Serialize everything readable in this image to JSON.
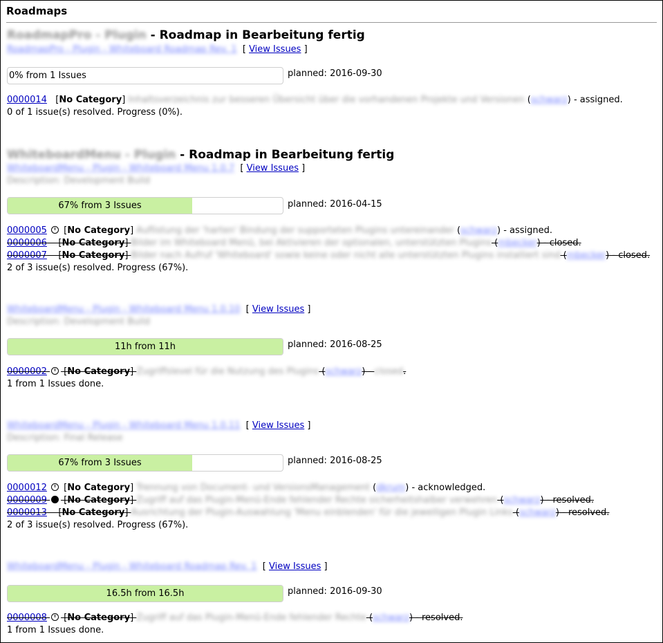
{
  "page": {
    "title": "Roadmaps"
  },
  "view_issues_label": "View Issues",
  "planned_label": "planned:",
  "blocks": [
    {
      "project": "RoadmapPro - Plugin",
      "heading_suffix": "- Roadmap in Bearbeitung fertig",
      "version_link": "RoadmapPro - Plugin - Whiteboard Roadmap Rev. 1",
      "description": "",
      "progress": {
        "text": "0% from 1 Issues",
        "fraction": 0.0
      },
      "planned_date": "2016-09-30",
      "issues": [
        {
          "id": "0000014",
          "icon": "",
          "category": "No Category",
          "summary": "Inhaltsverzeichnis zur besseren Übersicht über die vorhandenen Projekte und Versionen",
          "handler": "schwarz",
          "status": "assigned",
          "struck": false
        }
      ],
      "summary": "0 of 1 issue(s) resolved. Progress (0%)."
    },
    {
      "project": "WhiteboardMenu - Plugin",
      "heading_suffix": "- Roadmap in Bearbeitung fertig",
      "version_link": "WhiteboardMenu - Plugin - Whiteboard Menu 1.0.7",
      "description": "Description: Development Build",
      "progress": {
        "text": "67% from 3 Issues",
        "fraction": 0.67
      },
      "planned_date": "2016-04-15",
      "issues": [
        {
          "id": "0000005",
          "icon": "clock",
          "category": "No Category",
          "summary": "Auflistung der 'harten' Bindung der supporteten Plugins untereinander",
          "handler": "schwarz",
          "status": "assigned",
          "struck": false
        },
        {
          "id": "0000006",
          "icon": "",
          "category": "No Category",
          "summary": "Bilder im Whiteboard Menü, bei Aktivieren der optionalen, unterstützten Plugins",
          "handler": "mbecker",
          "status": "closed",
          "struck": true
        },
        {
          "id": "0000007",
          "icon": "",
          "category": "No Category",
          "summary": "Bilder nach Aufruf 'Whiteboard' sowie keine oder nicht alle unterstützten Plugins installiert sind",
          "handler": "mbecker",
          "status": "closed",
          "struck": true
        }
      ],
      "summary": "2 of 3 issue(s) resolved. Progress (67%)."
    },
    {
      "project": "",
      "heading_suffix": "",
      "version_link": "WhiteboardMenu - Plugin - Whiteboard Menu 1.0.10",
      "description": "Description: Development Build",
      "progress": {
        "text": "11h from 11h",
        "fraction": 1.0
      },
      "planned_date": "2016-08-25",
      "issues": [
        {
          "id": "0000002",
          "icon": "clock",
          "category": "No Category",
          "summary": "Zugriffslevel für die Nutzung des Plugins",
          "handler": "schwarz",
          "status": "closed",
          "struck": true
        }
      ],
      "summary": "1 from 1 Issues done."
    },
    {
      "project": "",
      "heading_suffix": "",
      "version_link": "WhiteboardMenu - Plugin - Whiteboard Menu 1.0.11",
      "description": "Description: Final Release",
      "progress": {
        "text": "67% from 3 Issues",
        "fraction": 0.67
      },
      "planned_date": "2016-08-25",
      "issues": [
        {
          "id": "0000012",
          "icon": "clock",
          "category": "No Category",
          "summary": "Trennung von Document- und VersionsManagement",
          "handler": "dkrum",
          "status": "acknowledged",
          "struck": false
        },
        {
          "id": "0000009",
          "icon": "clock-filled",
          "category": "No Category",
          "summary": "Zugriff auf das Plugin-Menü-Ende fehlender Rechte sicherheitshalber verwehren",
          "handler": "schwarz",
          "status": "resolved",
          "struck": true
        },
        {
          "id": "0000013",
          "icon": "",
          "category": "No Category",
          "summary": "Ausrichtung der Plugin-Auswahlung 'Menu einblenden' für die jeweiligen Plugin Links",
          "handler": "schwarz",
          "status": "resolved",
          "struck": true
        }
      ],
      "summary": "2 of 3 issue(s) resolved. Progress (67%)."
    },
    {
      "project": "",
      "heading_suffix": "",
      "version_link": "WhiteboardMenu - Plugin - Whiteboard Roadmap Rev. 1",
      "description": "",
      "progress": {
        "text": "16.5h from 16.5h",
        "fraction": 1.0
      },
      "planned_date": "2016-09-30",
      "issues": [
        {
          "id": "0000008",
          "icon": "clock",
          "category": "No Category",
          "summary": "Zugriff auf das Plugin-Menü-Ende fehlender Rechte",
          "handler": "schwarz",
          "status": "resolved",
          "struck": true
        }
      ],
      "summary": "1 from 1 Issues done."
    }
  ]
}
